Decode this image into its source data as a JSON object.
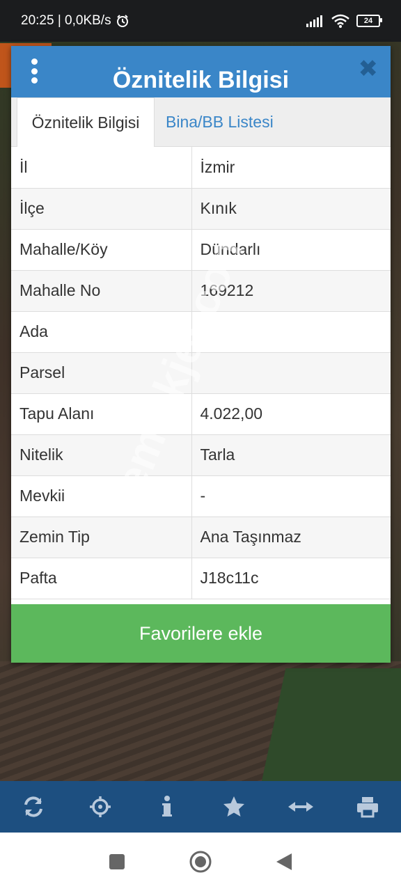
{
  "status": {
    "time_speed": "20:25 | 0,0KB/s",
    "battery": "24"
  },
  "dialog": {
    "title": "Öznitelik Bilgisi",
    "tabs": [
      {
        "label": "Öznitelik Bilgisi",
        "active": true
      },
      {
        "label": "Bina/BB Listesi",
        "active": false
      }
    ],
    "rows": [
      {
        "key": "İl",
        "value": "İzmir"
      },
      {
        "key": "İlçe",
        "value": "Kınık"
      },
      {
        "key": "Mahalle/Köy",
        "value": "Dündarlı"
      },
      {
        "key": "Mahalle No",
        "value": "169212"
      },
      {
        "key": "Ada",
        "value": ""
      },
      {
        "key": "Parsel",
        "value": ""
      },
      {
        "key": "Tapu Alanı",
        "value": "4.022,00"
      },
      {
        "key": "Nitelik",
        "value": "Tarla"
      },
      {
        "key": "Mevkii",
        "value": "-"
      },
      {
        "key": "Zemin Tip",
        "value": "Ana Taşınmaz"
      },
      {
        "key": "Pafta",
        "value": "J18c11c"
      }
    ],
    "favorite_label": "Favorilere ekle"
  },
  "watermark": "emlakjet.com",
  "toolbar": {
    "icons": [
      "refresh-icon",
      "locate-icon",
      "info-icon",
      "star-icon",
      "measure-icon",
      "print-icon"
    ]
  },
  "colors": {
    "header": "#3a86c8",
    "favorite": "#5cb85c",
    "toolbar": "#1d4f80"
  }
}
